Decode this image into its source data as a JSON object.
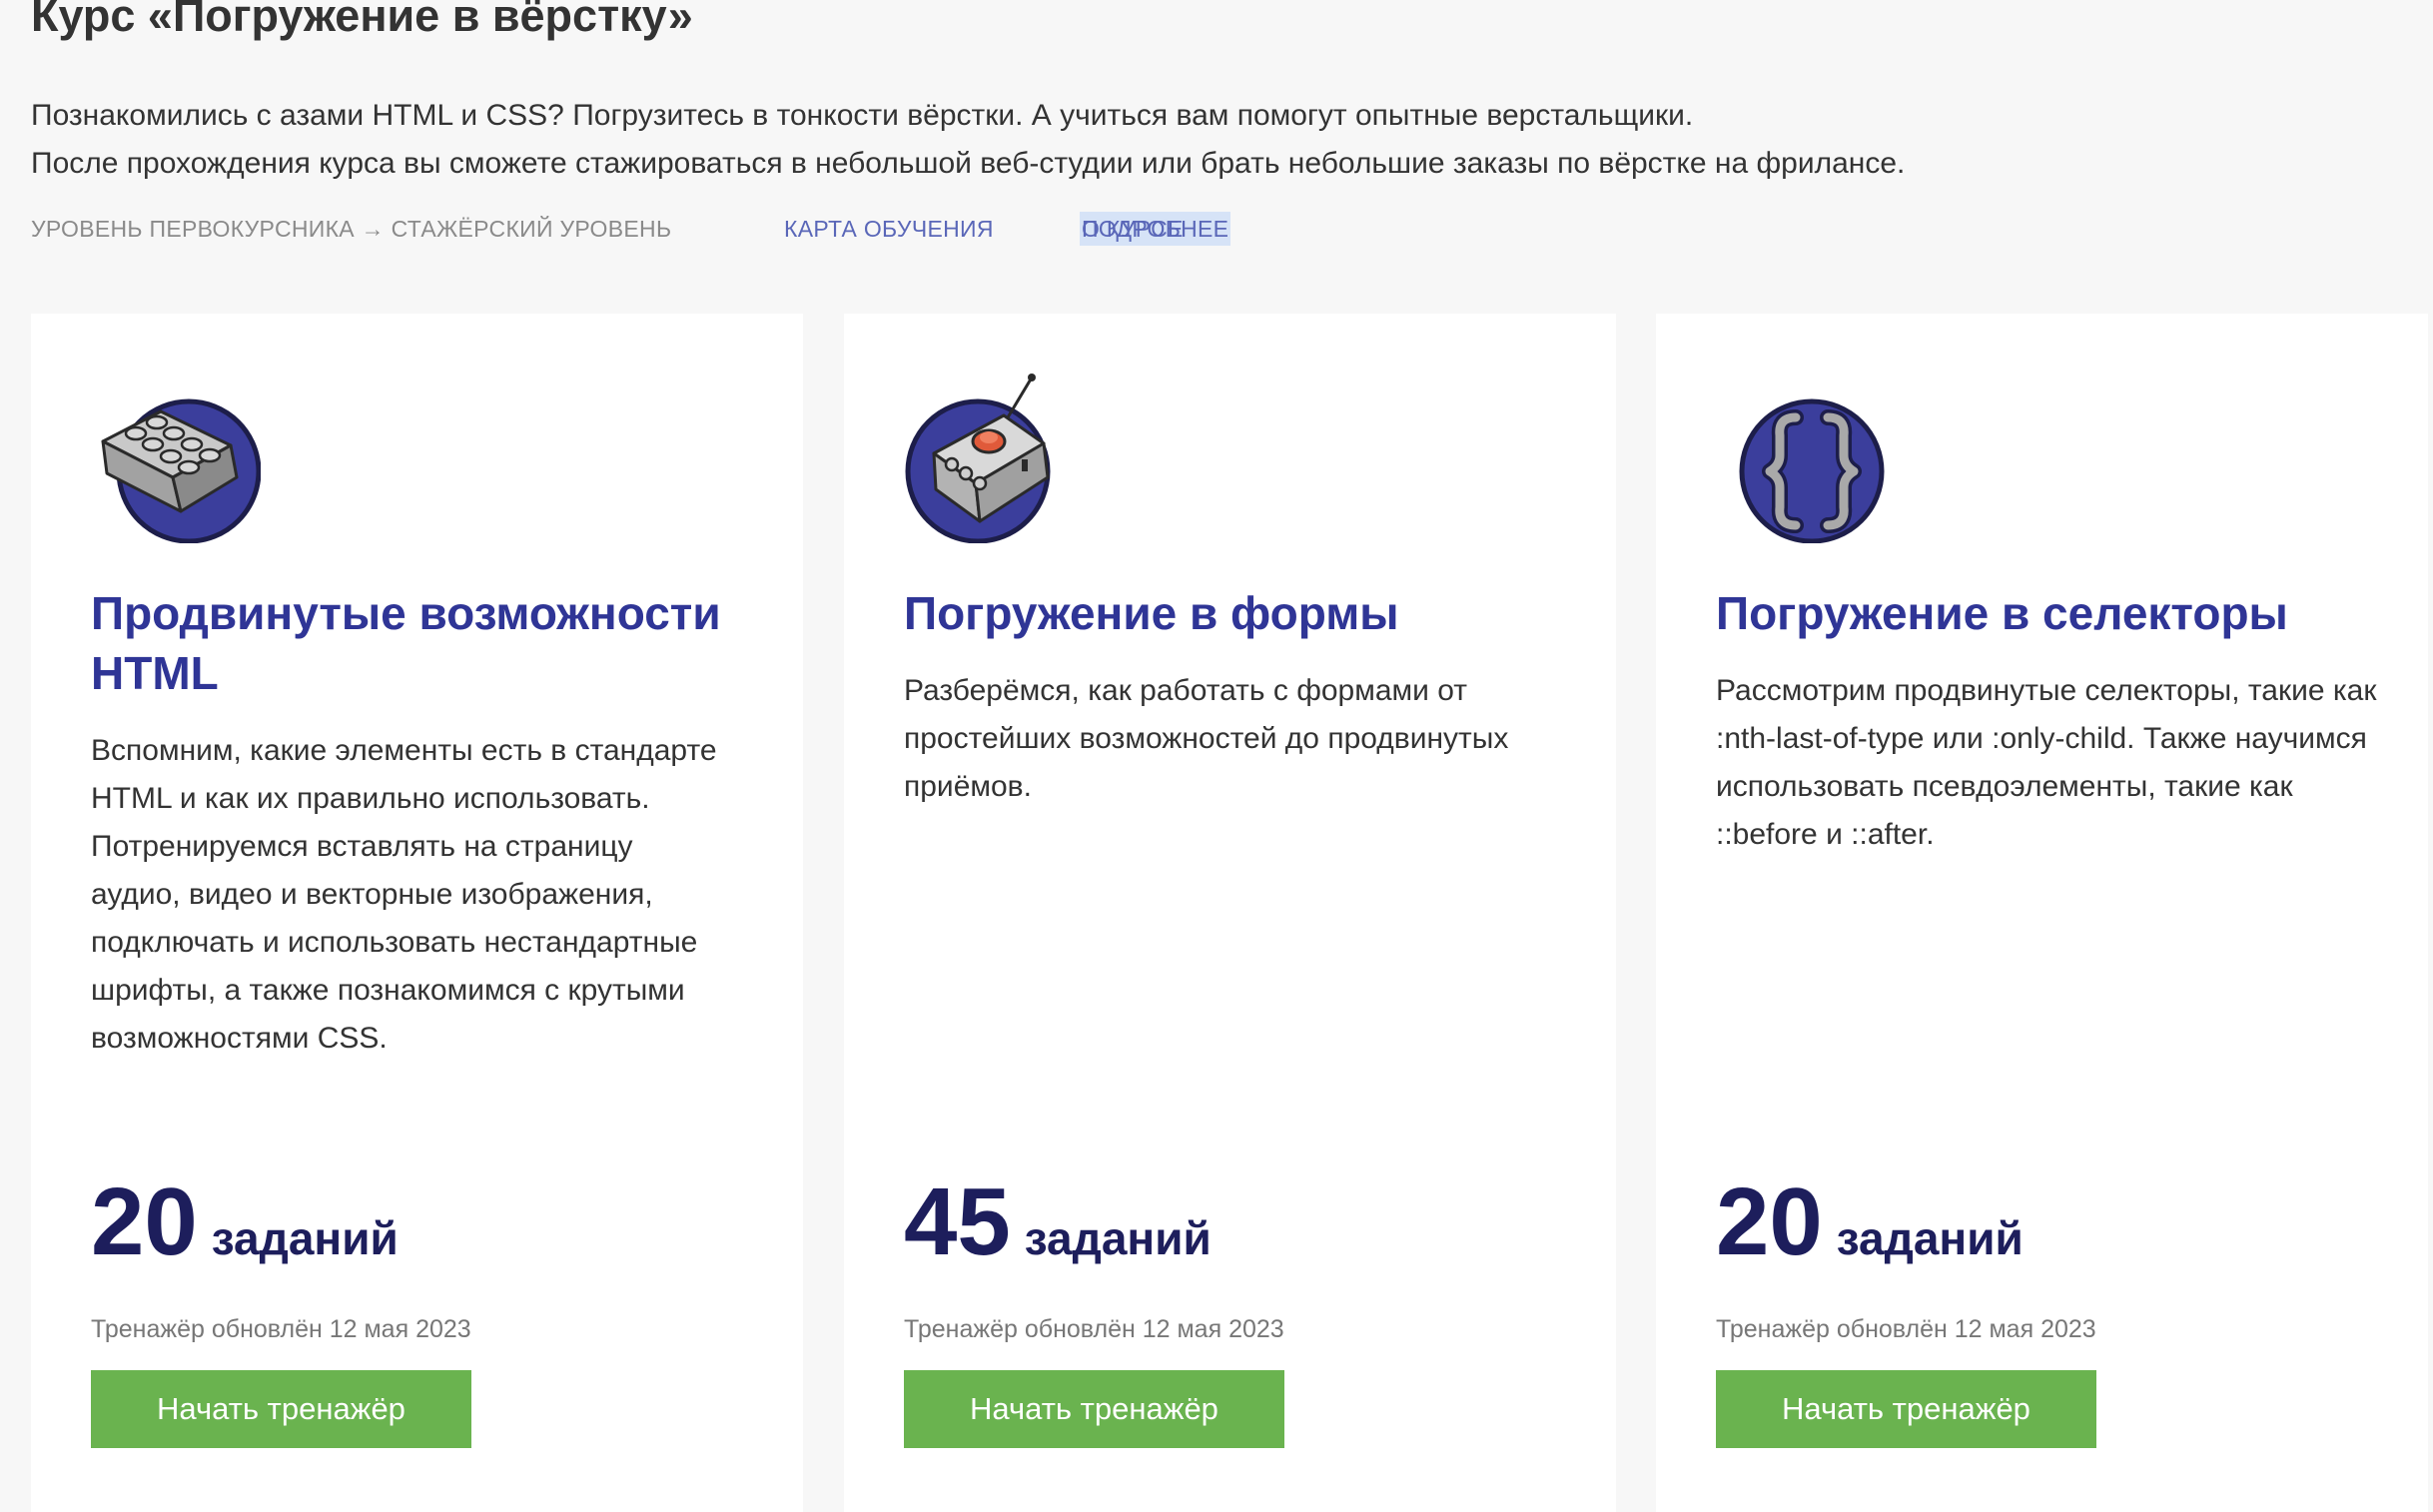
{
  "course": {
    "title": "Курс «Погружение в вёрстку»",
    "intro_line_1": "Познакомились с азами HTML и CSS? Погрузитесь в тонкости вёрстки. А учиться вам помогут опытные верстальщики.",
    "intro_line_2": "После прохождения курса вы сможете стажироваться в небольшой веб-студии или брать небольшие заказы по вёрстке на фрилансе.",
    "level_text": "УРОВЕНЬ ПЕРВОКУРСНИКА → СТАЖЁРСКИЙ УРОВЕНЬ",
    "map_link": "КАРТА ОБУЧЕНИЯ",
    "more_link_highlight": "ПОДРОБНЕЕ",
    "more_link_rest": " О КУРСЕ"
  },
  "colors": {
    "accent_title": "#2f3596",
    "tasks_number": "#1d1e5c",
    "button_green": "#6ab34f",
    "link": "#5a67b8",
    "icon_circle": "#3b3e9c"
  },
  "cards": [
    {
      "icon": "lego-brick-icon",
      "title": "Продвинутые возможности HTML",
      "description": "Вспомним, какие элементы есть в стандарте HTML и как их правильно использовать. Потренируемся вставлять на страницу аудио, видео и векторные изображения, подключать и использовать нестандартные шрифты, а также познакомимся с крутыми возможностями CSS.",
      "tasks_count": "20",
      "tasks_label": "заданий",
      "updated": "Тренажёр обновлён 12 мая 2023",
      "button": "Начать тренажёр"
    },
    {
      "icon": "remote-control-icon",
      "title": "Погружение в формы",
      "description": "Разберёмся, как работать с формами от простейших возможностей до продвинутых приёмов.",
      "tasks_count": "45",
      "tasks_label": "заданий",
      "updated": "Тренажёр обновлён 12 мая 2023",
      "button": "Начать тренажёр"
    },
    {
      "icon": "curly-braces-icon",
      "title": "Погружение в селекторы",
      "description": "Рассмотрим продвинутые селекторы, такие как :nth-last-of-type или :only-child. Также научимся использовать псевдоэлементы, такие как ::before и ::after.",
      "tasks_count": "20",
      "tasks_label": "заданий",
      "updated": "Тренажёр обновлён 12 мая 2023",
      "button": "Начать тренажёр"
    }
  ]
}
